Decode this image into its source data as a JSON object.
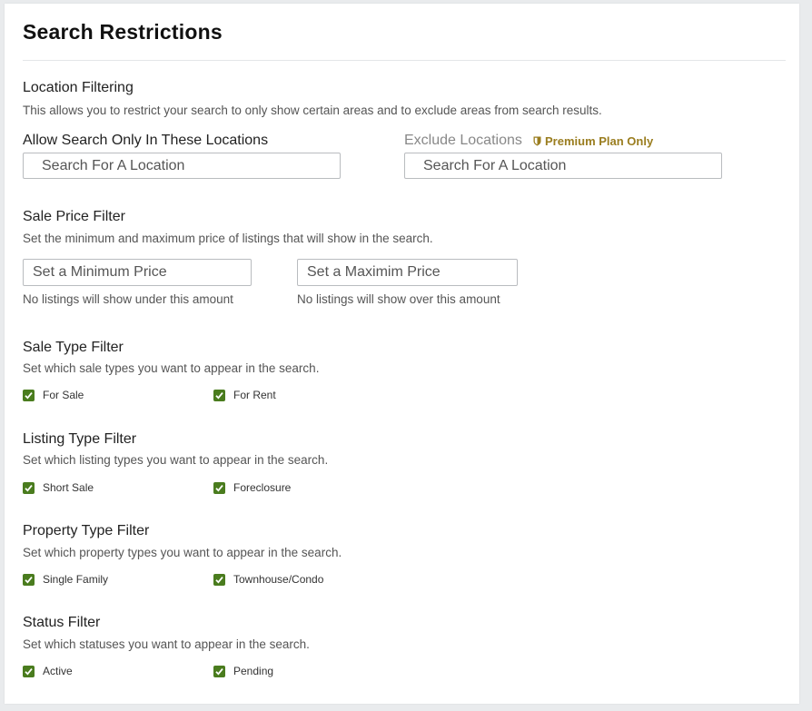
{
  "title": "Search Restrictions",
  "location": {
    "title": "Location Filtering",
    "desc": "This allows you to restrict your search to only show certain areas and to exclude areas from search results.",
    "allow_label": "Allow Search Only In These Locations",
    "allow_placeholder": "Search For A Location",
    "exclude_label": "Exclude Locations",
    "premium_label": "Premium Plan Only",
    "exclude_placeholder": "Search For A Location"
  },
  "price": {
    "title": "Sale Price Filter",
    "desc": "Set the minimum and maximum price of listings that will show in the search.",
    "min_placeholder": "Set a Minimum Price",
    "min_hint": "No listings will show under this amount",
    "max_placeholder": "Set a Maximim Price",
    "max_hint": "No listings will show over this amount"
  },
  "sale_type": {
    "title": "Sale Type Filter",
    "desc": "Set which sale types you want to appear in the search.",
    "options": [
      {
        "label": "For Sale",
        "checked": true
      },
      {
        "label": "For Rent",
        "checked": true
      }
    ]
  },
  "listing_type": {
    "title": "Listing Type Filter",
    "desc": "Set which listing types you want to appear in the search.",
    "options": [
      {
        "label": "Short Sale",
        "checked": true
      },
      {
        "label": "Foreclosure",
        "checked": true
      }
    ]
  },
  "property_type": {
    "title": "Property Type Filter",
    "desc": "Set which property types you want to appear in the search.",
    "options": [
      {
        "label": "Single Family",
        "checked": true
      },
      {
        "label": "Townhouse/Condo",
        "checked": true
      }
    ]
  },
  "status": {
    "title": "Status Filter",
    "desc": "Set which statuses you want to appear in the search.",
    "options": [
      {
        "label": "Active",
        "checked": true
      },
      {
        "label": "Pending",
        "checked": true
      }
    ]
  },
  "colors": {
    "checkbox": "#4a7c1e",
    "premium": "#9a7d1f"
  }
}
